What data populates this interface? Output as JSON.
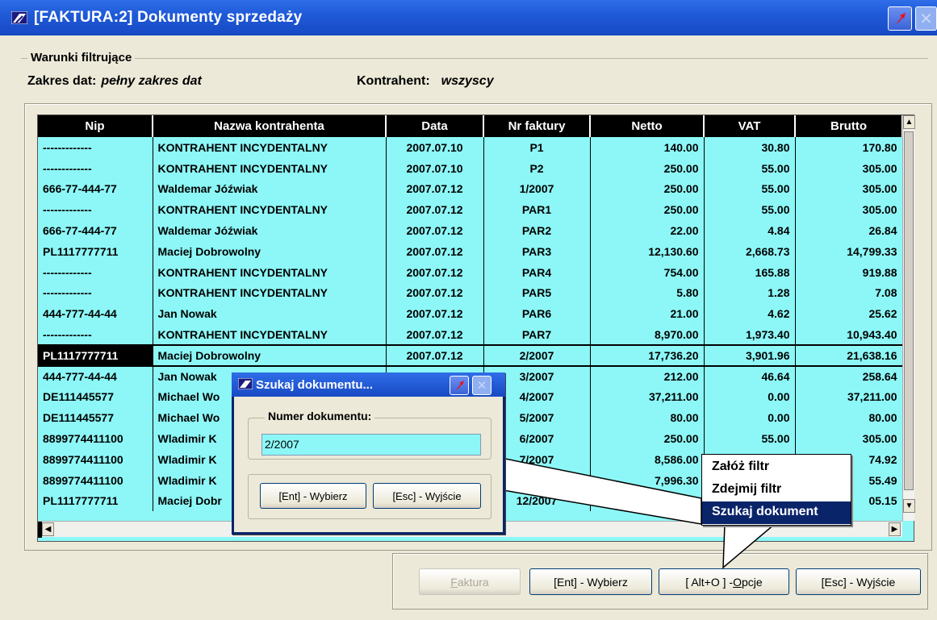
{
  "window": {
    "title": "[FAKTURA:2]  Dokumenty sprzedaży"
  },
  "filters": {
    "legend": "Warunki filtrujące",
    "date_label": "Zakres dat:",
    "date_value": "pełny zakres dat",
    "contractor_label": "Kontrahent:",
    "contractor_value": "wszyscy"
  },
  "grid": {
    "columns": [
      "Nip",
      "Nazwa kontrahenta",
      "Data",
      "Nr faktury",
      "Netto",
      "VAT",
      "Brutto"
    ],
    "rows": [
      [
        "-------------",
        "KONTRAHENT INCYDENTALNY",
        "2007.07.10",
        "P1",
        "140.00",
        "30.80",
        "170.80"
      ],
      [
        "-------------",
        "KONTRAHENT INCYDENTALNY",
        "2007.07.10",
        "P2",
        "250.00",
        "55.00",
        "305.00"
      ],
      [
        "666-77-444-77",
        "Waldemar Jóźwiak",
        "2007.07.12",
        "1/2007",
        "250.00",
        "55.00",
        "305.00"
      ],
      [
        "-------------",
        "KONTRAHENT INCYDENTALNY",
        "2007.07.12",
        "PAR1",
        "250.00",
        "55.00",
        "305.00"
      ],
      [
        "666-77-444-77",
        "Waldemar Jóźwiak",
        "2007.07.12",
        "PAR2",
        "22.00",
        "4.84",
        "26.84"
      ],
      [
        "PL1117777711",
        "Maciej Dobrowolny",
        "2007.07.12",
        "PAR3",
        "12,130.60",
        "2,668.73",
        "14,799.33"
      ],
      [
        "-------------",
        "KONTRAHENT INCYDENTALNY",
        "2007.07.12",
        "PAR4",
        "754.00",
        "165.88",
        "919.88"
      ],
      [
        "-------------",
        "KONTRAHENT INCYDENTALNY",
        "2007.07.12",
        "PAR5",
        "5.80",
        "1.28",
        "7.08"
      ],
      [
        "444-777-44-44",
        "Jan Nowak",
        "2007.07.12",
        "PAR6",
        "21.00",
        "4.62",
        "25.62"
      ],
      [
        "-------------",
        "KONTRAHENT INCYDENTALNY",
        "2007.07.12",
        "PAR7",
        "8,970.00",
        "1,973.40",
        "10,943.40"
      ],
      [
        "PL1117777711",
        "Maciej Dobrowolny",
        "2007.07.12",
        "2/2007",
        "17,736.20",
        "3,901.96",
        "21,638.16"
      ],
      [
        "444-777-44-44",
        "Jan Nowak",
        "",
        "3/2007",
        "212.00",
        "46.64",
        "258.64"
      ],
      [
        "DE111445577",
        "Michael Wo",
        "",
        "4/2007",
        "37,211.00",
        "0.00",
        "37,211.00"
      ],
      [
        "DE111445577",
        "Michael Wo",
        "",
        "5/2007",
        "80.00",
        "0.00",
        "80.00"
      ],
      [
        "8899774411100",
        "Wladimir K",
        "",
        "6/2007",
        "250.00",
        "55.00",
        "305.00"
      ],
      [
        "8899774411100",
        "Wladimir K",
        "",
        "7/2007",
        "8,586.00",
        "",
        "74.92"
      ],
      [
        "8899774411100",
        "Wladimir K",
        "",
        "",
        "7,996.30",
        "",
        "55.49"
      ],
      [
        "PL1117777711",
        "Maciej Dobr",
        "",
        "12/2007",
        "",
        "",
        "05.15"
      ]
    ],
    "selected_row": 10
  },
  "buttons": {
    "faktura": "Faktura",
    "faktura_hotkey": "F",
    "faktura_rest": "aktura",
    "wybierz": "[Ent] - Wybierz",
    "opcje_prefix": "[ Alt+O ] - ",
    "opcje_hotkey": "O",
    "opcje_rest": "pcje",
    "wyjscie": "[Esc] - Wyjście"
  },
  "dialog": {
    "title": "Szukaj dokumentu...",
    "field_legend": "Numer dokumentu:",
    "field_value": "2/2007",
    "btn_wybierz": "[Ent] - Wybierz",
    "btn_wyjscie": "[Esc] - Wyjście"
  },
  "menu": {
    "items": [
      "Załóż filtr",
      "Zdejmij filtr",
      "Szukaj dokument"
    ],
    "active_index": 2
  },
  "colors": {
    "grid_bg": "#8df7f7",
    "header_bg": "#000000",
    "titlebar": "#1f5ad8",
    "menu_active": "#0a246a"
  }
}
